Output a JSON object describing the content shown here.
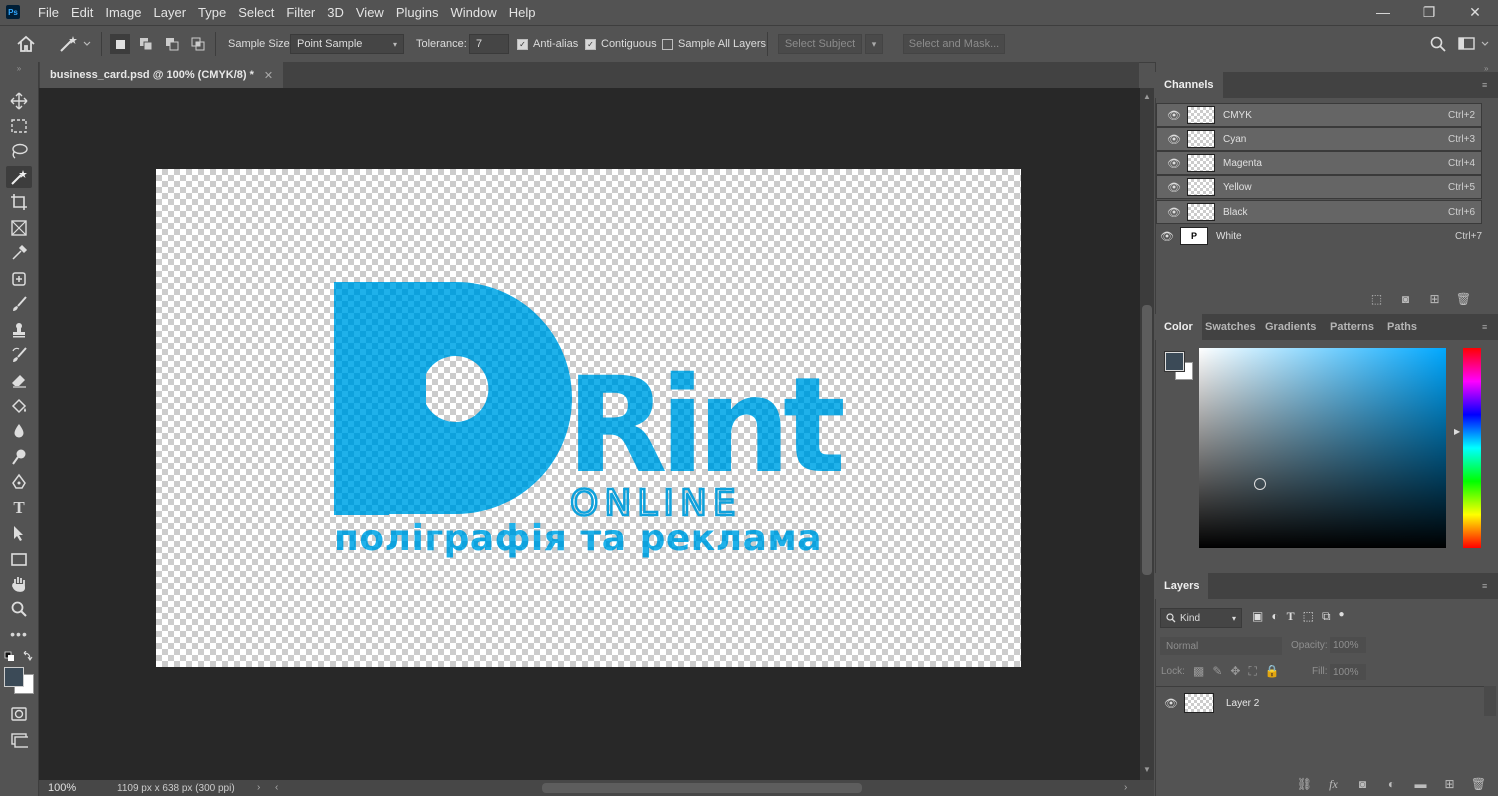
{
  "app": {
    "logo_text": "Ps"
  },
  "menu": [
    "File",
    "Edit",
    "Image",
    "Layer",
    "Type",
    "Select",
    "Filter",
    "3D",
    "View",
    "Plugins",
    "Window",
    "Help"
  ],
  "window_controls": {
    "minimize": "—",
    "restore": "❐",
    "close": "✕"
  },
  "options_bar": {
    "sample_size_label": "Sample Size:",
    "sample_size_value": "Point Sample",
    "tolerance_label": "Tolerance:",
    "tolerance_value": "7",
    "anti_alias": "Anti-alias",
    "contiguous": "Contiguous",
    "sample_all_layers": "Sample All Layers",
    "select_subject": "Select Subject",
    "select_and_mask": "Select and Mask..."
  },
  "document": {
    "tab_title": "business_card.psd @ 100% (CMYK/8) *",
    "logo_word": "Rint",
    "logo_online": "ONLINE",
    "logo_tagline": "поліграфія та реклама",
    "logo_color": "#0ea1dc"
  },
  "status": {
    "zoom": "100%",
    "doc_info": "1109 px x 638 px (300 ppi)"
  },
  "channels": {
    "title": "Channels",
    "items": [
      {
        "name": "CMYK",
        "shortcut": "Ctrl+2"
      },
      {
        "name": "Cyan",
        "shortcut": "Ctrl+3"
      },
      {
        "name": "Magenta",
        "shortcut": "Ctrl+4"
      },
      {
        "name": "Yellow",
        "shortcut": "Ctrl+5"
      },
      {
        "name": "Black",
        "shortcut": "Ctrl+6"
      },
      {
        "name": "White",
        "shortcut": "Ctrl+7"
      }
    ]
  },
  "color_panel": {
    "tabs": [
      "Color",
      "Swatches",
      "Gradients",
      "Patterns",
      "Paths"
    ],
    "foreground": "#3b4a57",
    "background": "#ffffff",
    "hue_color": "#00a8ff"
  },
  "layers": {
    "title": "Layers",
    "filter_kind": "Kind",
    "blend_mode": "Normal",
    "opacity_label": "Opacity:",
    "opacity_value": "100%",
    "lock_label": "Lock:",
    "fill_label": "Fill:",
    "fill_value": "100%",
    "items": [
      {
        "name": "Layer 2"
      }
    ]
  }
}
